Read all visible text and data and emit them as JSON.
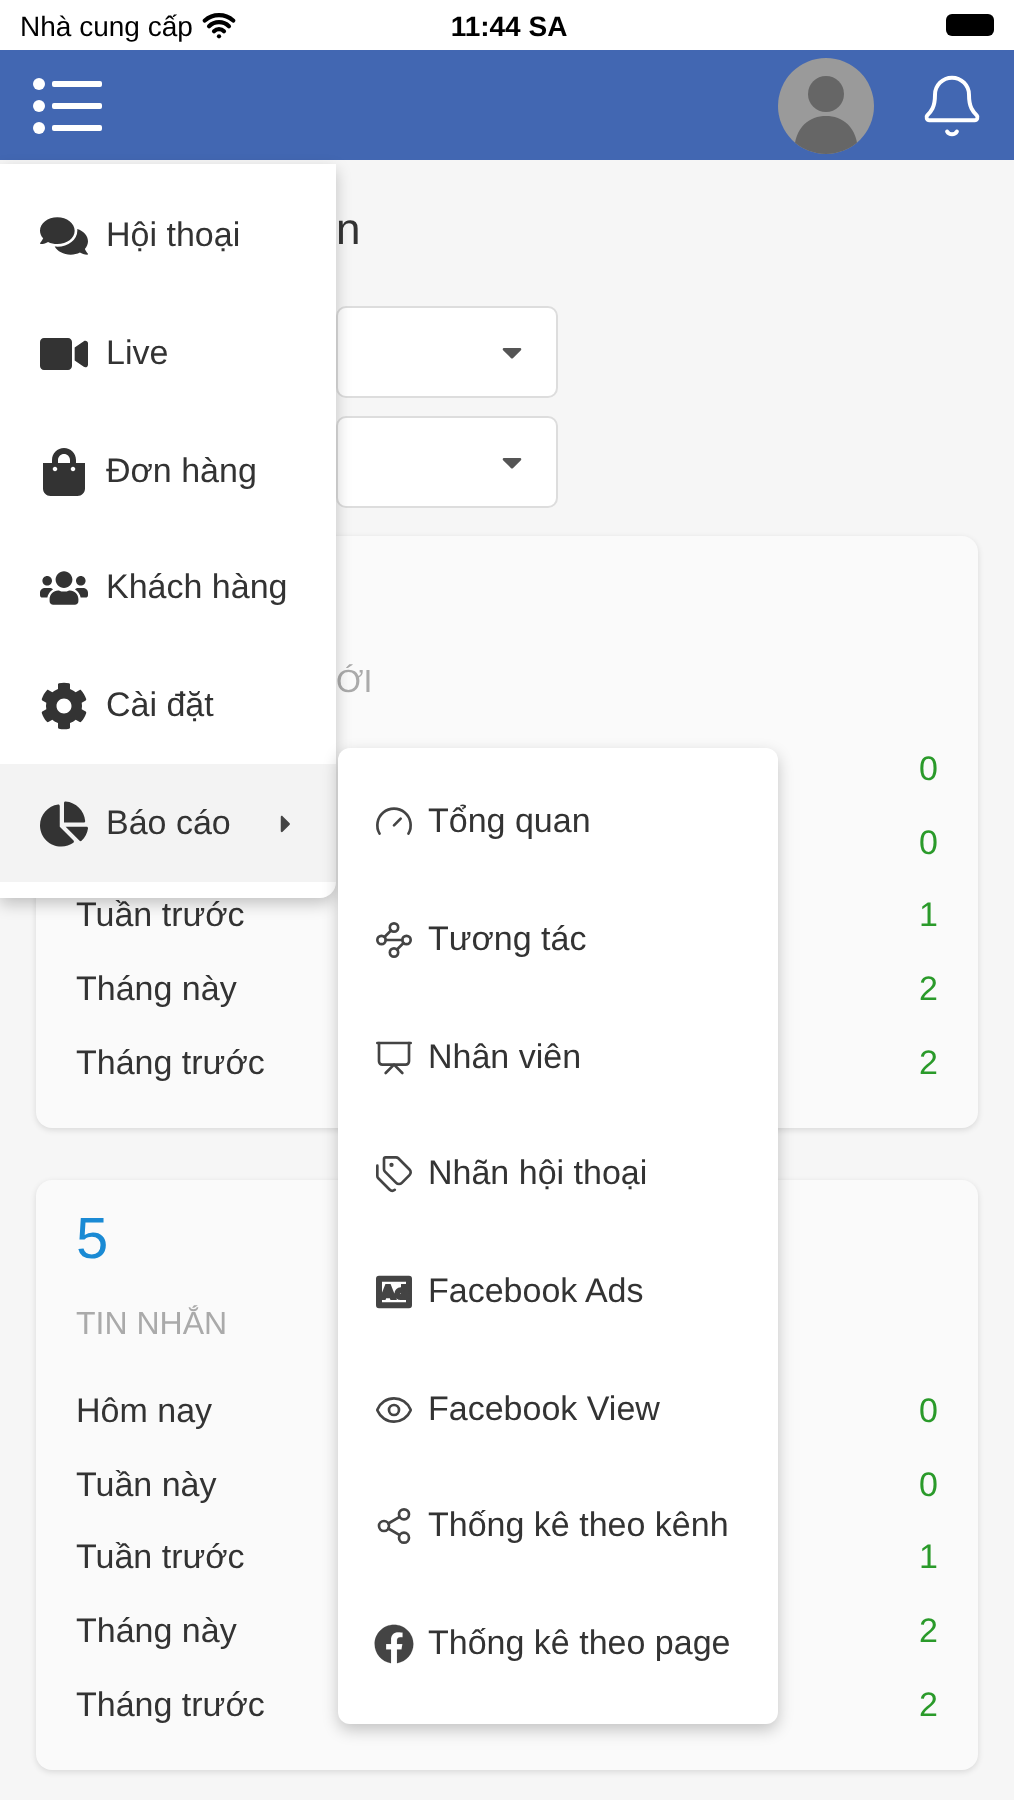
{
  "status_bar": {
    "carrier": "Nhà cung cấp",
    "time": "11:44 SA"
  },
  "page": {
    "heading": "n",
    "dropdowns": [
      {
        "expanded": false
      },
      {
        "expanded": false
      }
    ],
    "cards": [
      {
        "label": "ỚI",
        "rows": [
          {
            "value": "0"
          },
          {
            "value": "0"
          },
          {
            "label": "Tuần trước",
            "value": "1"
          },
          {
            "label": "Tháng này",
            "value": "2"
          },
          {
            "label": "Tháng trước",
            "value": "2"
          }
        ]
      },
      {
        "number": "5",
        "label": "TIN NHẮN",
        "rows": [
          {
            "label": "Hôm nay",
            "value": "0"
          },
          {
            "label": "Tuần này",
            "value": "0"
          },
          {
            "label": "Tuần trước",
            "value": "1"
          },
          {
            "label": "Tháng này",
            "value": "2"
          },
          {
            "label": "Tháng trước",
            "value": "2"
          }
        ]
      }
    ]
  },
  "menu": {
    "items": [
      {
        "label": "Hội thoại",
        "kind": "link",
        "selected": false
      },
      {
        "label": "Live",
        "kind": "link",
        "selected": false
      },
      {
        "label": "Đơn hàng",
        "kind": "link",
        "selected": false
      },
      {
        "label": "Khách hàng",
        "kind": "link",
        "selected": false
      },
      {
        "label": "Cài đặt",
        "kind": "link",
        "selected": false
      },
      {
        "label": "Báo cáo",
        "kind": "submenu",
        "selected": true
      }
    ]
  },
  "submenu": {
    "items": [
      {
        "label": "Tổng quan"
      },
      {
        "label": "Tương tác"
      },
      {
        "label": "Nhân viên"
      },
      {
        "label": "Nhãn hội thoại"
      },
      {
        "label": "Facebook Ads"
      },
      {
        "label": "Facebook View"
      },
      {
        "label": "Thống kê theo kênh"
      },
      {
        "label": "Thống kê theo page"
      }
    ]
  }
}
